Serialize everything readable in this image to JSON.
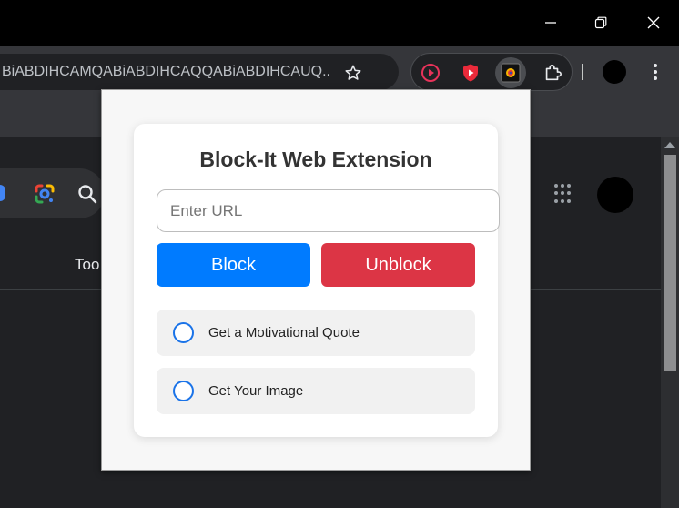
{
  "window": {
    "minimize_icon": "minimize-icon",
    "restore_icon": "restore-icon",
    "close_icon": "close-icon"
  },
  "toolbar": {
    "address_text": "BiABDIHCAMQABiABDIHCAQQABiABDIHCAUQ...",
    "bookmark_icon": "star-icon",
    "extensions": [
      "play-circle-icon",
      "shield-play-icon",
      "block-it-icon",
      "puzzle-icon"
    ],
    "menu_icon": "kebab-menu-icon"
  },
  "page": {
    "tools_text": "Too"
  },
  "popup": {
    "title": "Block-It Web Extension",
    "url_placeholder": "Enter URL",
    "url_value": "",
    "block_label": "Block",
    "unblock_label": "Unblock",
    "options": [
      {
        "label": "Get a Motivational Quote",
        "selected": false
      },
      {
        "label": "Get Your Image",
        "selected": false
      }
    ],
    "colors": {
      "block": "#007bff",
      "unblock": "#dc3545",
      "radio": "#1a73e8"
    }
  }
}
